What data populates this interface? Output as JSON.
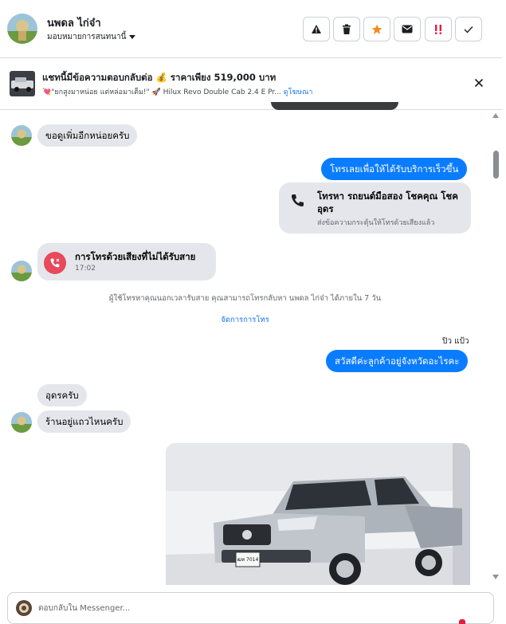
{
  "header": {
    "contact_name": "นพดล ไก่จ๋า",
    "assign_label": "มอบหมายการสนทนานี้"
  },
  "banner": {
    "title": "แชทนี้มีข้อความตอบกลับต่อ 💰 ราคาเพียง 519,000 บาท",
    "subtitle": "💘\"ยกสูงมาหน่อย แต่หล่อมาเต็ม!\" 🚀 Hilux Revo Double Cab 2.4 E Pr...",
    "link": "ดูโฆษณา"
  },
  "messages": {
    "in_1": "ขอดูเพิ่มอีกหน่อยครับ",
    "out_1": "โทรเลยเพื่อให้ได้รับบริการเร็วขึ้น",
    "call_card_title": "โทรหา รถยนต์มือสอง โชคคุณ โชค อุดร",
    "call_card_sub": "ส่งข้อความกระตุ้นให้โทรด้วยเสียงแล้ว",
    "missed_title": "การโทรด้วยเสียงที่ไม่ได้รับสาย",
    "missed_time": "17:02",
    "system_note": "ผู้ใช้โทรหาคุณนอกเวลารับสาย คุณสามารถโทรกลับหา นพดล ไก่จ๋า ได้ภายใน 7 วัน",
    "system_link": "จัดการการโทร",
    "sender_name": "ปิว แป้ว",
    "out_2": "สวัสดีค่ะลูกค้าอยู่จังหวัดอะไรคะ",
    "in_2": "อุดรครับ",
    "in_3": "ร้านอยู่แถวไหนครับ",
    "plate_text": "ฒท 7014"
  },
  "composer": {
    "placeholder": "ตอบกลับใน Messenger..."
  },
  "colors": {
    "outgoing_bubble": "#0a7cff",
    "incoming_bubble": "#e4e6eb",
    "link": "#1877f2",
    "missed_call_icon": "#e8495b"
  },
  "icons": [
    "alert-triangle-icon",
    "trash-icon",
    "star-icon",
    "envelope-icon",
    "double-exclamation-icon",
    "check-icon",
    "close-icon",
    "phone-icon",
    "missed-call-icon",
    "caret-down-icon"
  ]
}
